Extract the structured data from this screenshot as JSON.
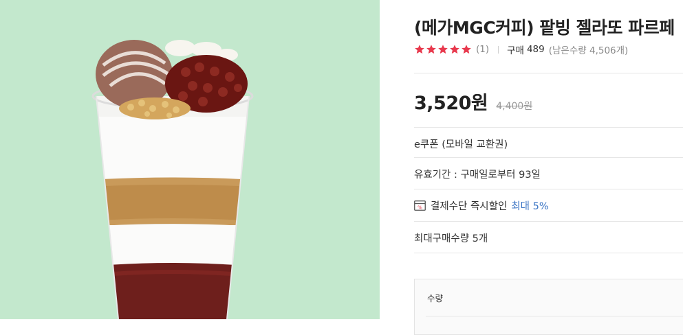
{
  "product": {
    "title": "(메가MGC커피) 팥빙 젤라또 파르페",
    "image_alt": "팥빙 젤라또 파르페",
    "rating": 5,
    "review_count": "(1)",
    "sold_label": "구매",
    "sold_count": "489",
    "remaining": "(남은수량 4,506개)",
    "price": "3,520원",
    "original_price": "4,400원"
  },
  "info": {
    "type": "e쿠폰 (모바일 교환권)",
    "validity": "유효기간 : 구매일로부터 93일",
    "discount_label": "결제수단 즉시할인",
    "discount_value": "최대 5%",
    "max_qty": "최대구매수량 5개"
  },
  "quantity": {
    "label": "수량"
  },
  "colors": {
    "star": "#e8394d",
    "accent_link": "#3a74c4",
    "image_bg": "#c3e8cd"
  },
  "icons": {
    "star": "star-icon",
    "discount": "card-discount-icon"
  }
}
